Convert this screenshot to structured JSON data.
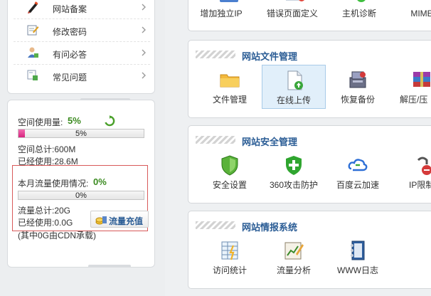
{
  "sidebar": {
    "menu": [
      {
        "label": "网站备案",
        "icon": "pen-icon"
      },
      {
        "label": "修改密码",
        "icon": "edit-document-icon"
      },
      {
        "label": "有问必答",
        "icon": "user-help-icon"
      },
      {
        "label": "常见问题",
        "icon": "faq-icon"
      }
    ],
    "space": {
      "usage_label": "空间使用量:",
      "usage_pct": "5%",
      "usage_fraction": 0.05,
      "bar_text": "5%",
      "total": "空间总计:600M",
      "used": "已经使用:28.6M"
    },
    "traffic": {
      "usage_label": "本月流量使用情况:",
      "usage_pct": "0%",
      "usage_fraction": 0.0,
      "bar_text": "0%",
      "total": "流量总计:20G",
      "used": "已经使用:0.0G",
      "note": "(其中0G由CDN承载)",
      "recharge_label": "流量充值"
    }
  },
  "top_row": {
    "tools": [
      "增加独立IP",
      "错误页面定义",
      "主机诊断",
      "MIME类"
    ]
  },
  "sections": [
    {
      "title": "网站文件管理",
      "tools": [
        {
          "label": "文件管理",
          "icon": "folder-icon",
          "selected": false
        },
        {
          "label": "在线上传",
          "icon": "upload-file-icon",
          "selected": true
        },
        {
          "label": "恢复备份",
          "icon": "restore-backup-icon",
          "selected": false
        },
        {
          "label": "解压/压",
          "icon": "archive-icon",
          "selected": false
        }
      ]
    },
    {
      "title": "网站安全管理",
      "tools": [
        {
          "label": "安全设置",
          "icon": "shield-icon",
          "selected": false
        },
        {
          "label": "360攻击防护",
          "icon": "shield-plus-icon",
          "selected": false
        },
        {
          "label": "百度云加速",
          "icon": "cloud-accelerate-icon",
          "selected": false
        },
        {
          "label": "IP限制",
          "icon": "ip-block-icon",
          "selected": false
        }
      ]
    },
    {
      "title": "网站情报系统",
      "tools": [
        {
          "label": "访问统计",
          "icon": "stats-chart-icon",
          "selected": false
        },
        {
          "label": "流量分析",
          "icon": "traffic-analysis-icon",
          "selected": false
        },
        {
          "label": "WWW日志",
          "icon": "log-book-icon",
          "selected": false
        }
      ]
    }
  ],
  "colors": {
    "accent_blue": "#2a5c95",
    "usage_green": "#3a8a1f",
    "bar_pink": "#d6247f",
    "alert_border": "#d85a5a",
    "selected_bg": "#e1effa"
  }
}
